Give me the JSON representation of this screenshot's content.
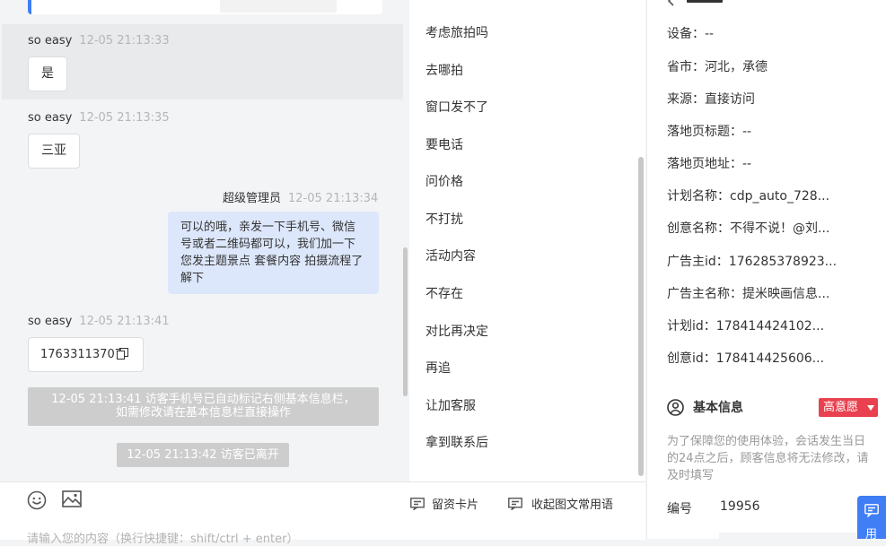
{
  "chat": {
    "messages": [
      {
        "sender": "so easy",
        "time": "12-05 21:13:33",
        "text": "是"
      },
      {
        "sender": "so easy",
        "time": "12-05 21:13:35",
        "text": "三亚"
      },
      {
        "sender": "超级管理员",
        "time": "12-05 21:13:34",
        "text": "可以的哦，亲发一下手机号、微信号或者二维码都可以，我们加一下您发主题景点 套餐内容 拍摄流程了解下"
      },
      {
        "sender": "so easy",
        "time": "12-05 21:13:41",
        "text": "17633113707"
      }
    ],
    "system": [
      {
        "line1": "12-05 21:13:41 访客手机号已自动标记右侧基本信息栏，",
        "line2": "如需修改请在基本信息栏直接操作"
      },
      {
        "line1": "12-05 21:13:42 访客已离开"
      }
    ]
  },
  "quick_replies": [
    "考虑旅拍吗",
    "去哪拍",
    "窗口发不了",
    "要电话",
    "问价格",
    "不打扰",
    "活动内容",
    "不存在",
    "对比再决定",
    "再追",
    "让加客服",
    "拿到联系后"
  ],
  "toolbar": {
    "card_label": "留资卡片",
    "collapse_label": "收起图文常用语",
    "input_placeholder": "请输入您的内容（换行快捷键：shift/ctrl + enter）"
  },
  "visitor_info": [
    {
      "label": "设备：",
      "value": "--"
    },
    {
      "label": "省市：",
      "value": "河北，承德"
    },
    {
      "label": "来源：",
      "value": "直接访问"
    },
    {
      "label": "落地页标题：",
      "value": "--"
    },
    {
      "label": "落地页地址：",
      "value": "--"
    },
    {
      "label": "计划名称：",
      "value": "cdp_auto_728..."
    },
    {
      "label": "创意名称：",
      "value": "不得不说！@刘..."
    },
    {
      "label": "广告主id：",
      "value": "176285378923..."
    },
    {
      "label": "广告主名称：",
      "value": "提米映画信息..."
    },
    {
      "label": "计划id：",
      "value": "178414424102..."
    },
    {
      "label": "创意id：",
      "value": "178414425606..."
    }
  ],
  "basic_info": {
    "title": "基本信息",
    "badge": "高意愿",
    "note": "为了保障您的使用体验，会话发生当日的24点之后，顾客信息将无法修改，请及时填写",
    "id_label": "编号",
    "id_value": "19956"
  },
  "float_button": {
    "label": "用"
  },
  "colors": {
    "accent": "#3f7ef5",
    "badge": "#e9414f",
    "bubble_out": "#dde7fb"
  }
}
